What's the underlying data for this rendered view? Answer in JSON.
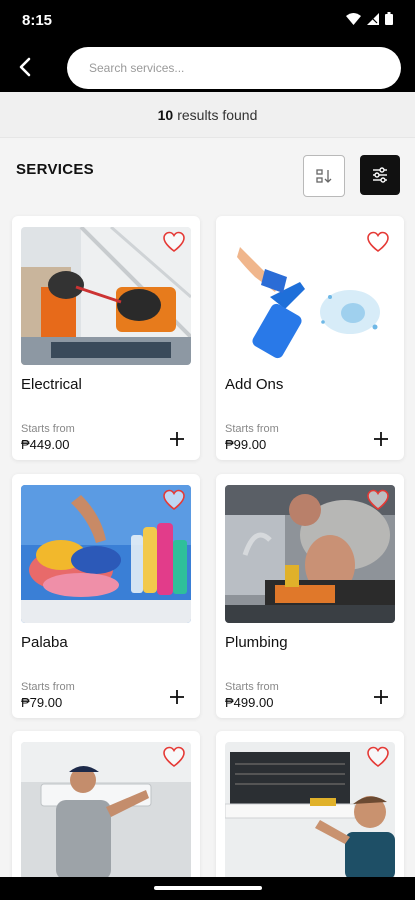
{
  "status": {
    "time": "8:15"
  },
  "search": {
    "placeholder": "Search services..."
  },
  "results": {
    "count": "10",
    "text": "results found"
  },
  "section": {
    "title": "SERVICES"
  },
  "colors": {
    "header_bg": "#000000",
    "accent_heart": "#e53935"
  },
  "services": [
    {
      "name": "Electrical",
      "starts_label": "Starts from",
      "price": "₱449.00",
      "image": "electrician-photo"
    },
    {
      "name": "Add Ons",
      "starts_label": "Starts from",
      "price": "₱99.00",
      "image": "spray-bottle-illustration"
    },
    {
      "name": "Palaba",
      "starts_label": "Starts from",
      "price": "₱79.00",
      "image": "laundry-photo"
    },
    {
      "name": "Plumbing",
      "starts_label": "Starts from",
      "price": "₱499.00",
      "image": "plumber-photo"
    },
    {
      "name": "",
      "starts_label": "",
      "price": "",
      "image": "aircon-technician-photo"
    },
    {
      "name": "",
      "starts_label": "",
      "price": "",
      "image": "aircon-repair-photo"
    }
  ]
}
